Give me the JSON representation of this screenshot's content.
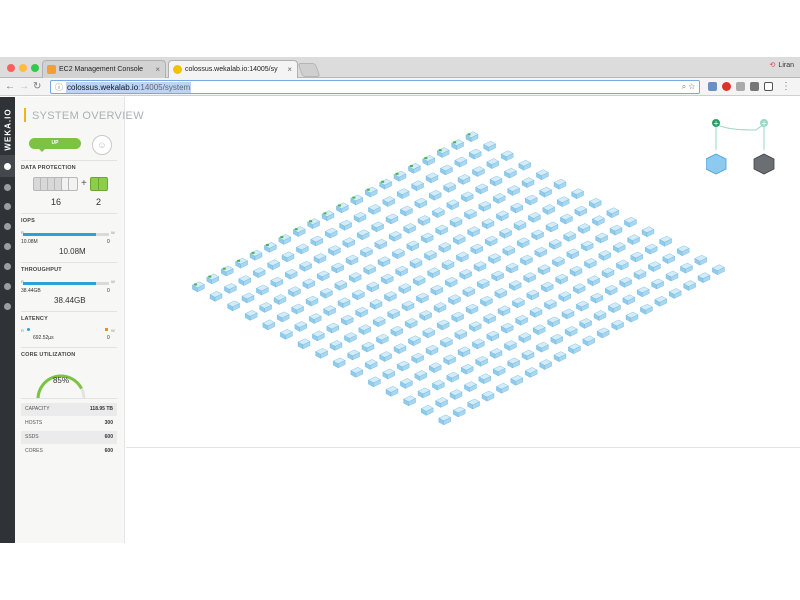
{
  "browser": {
    "tabs": [
      {
        "label": "EC2 Management Console",
        "favicon_color": "#f0a030"
      },
      {
        "label": "colossus.wekalab.io:14005/sy",
        "favicon_color": "#f2c200"
      }
    ],
    "user": "Liran",
    "url_host": "colossus.wekalab.io",
    "url_path": ":14005/system"
  },
  "rail": {
    "logo": "WEKA.IO"
  },
  "sidebar": {
    "page_title": "SYSTEM OVERVIEW",
    "status": "UP",
    "data_protection": {
      "heading": "DATA PROTECTION",
      "data_drives": "16",
      "plus": "+",
      "parity_drives": "2"
    },
    "iops": {
      "heading": "IOPS",
      "read_tag": "R",
      "write_tag": "W",
      "read_value": "10.08M",
      "write_value": "0",
      "total": "10.08M",
      "read_fraction": 0.85
    },
    "throughput": {
      "heading": "THROUGHPUT",
      "read_tag": "R",
      "write_tag": "W",
      "read_value": "38.44GB",
      "write_value": "0",
      "total": "38.44GB",
      "read_fraction": 0.85
    },
    "latency": {
      "heading": "LATENCY",
      "read_tag": "R",
      "write_tag": "W",
      "read_value": "692.52µs",
      "write_value": "0"
    },
    "core_utilization": {
      "heading": "CORE UTILIZATION",
      "value": "85%",
      "fraction": 0.85
    },
    "stats": [
      {
        "label": "CAPACITY",
        "value": "118.95 TB"
      },
      {
        "label": "HOSTS",
        "value": "300"
      },
      {
        "label": "SSDS",
        "value": "600"
      },
      {
        "label": "CORES",
        "value": "600"
      }
    ]
  },
  "cluster": {
    "rows": 20,
    "cols": 15,
    "host_color": "#a8d8f0",
    "led_color": "#4caf50"
  },
  "colors": {
    "accent": "#f0b619",
    "status_up": "#7cc243",
    "bar": "#2f9fd8",
    "rail": "#2f3236"
  }
}
